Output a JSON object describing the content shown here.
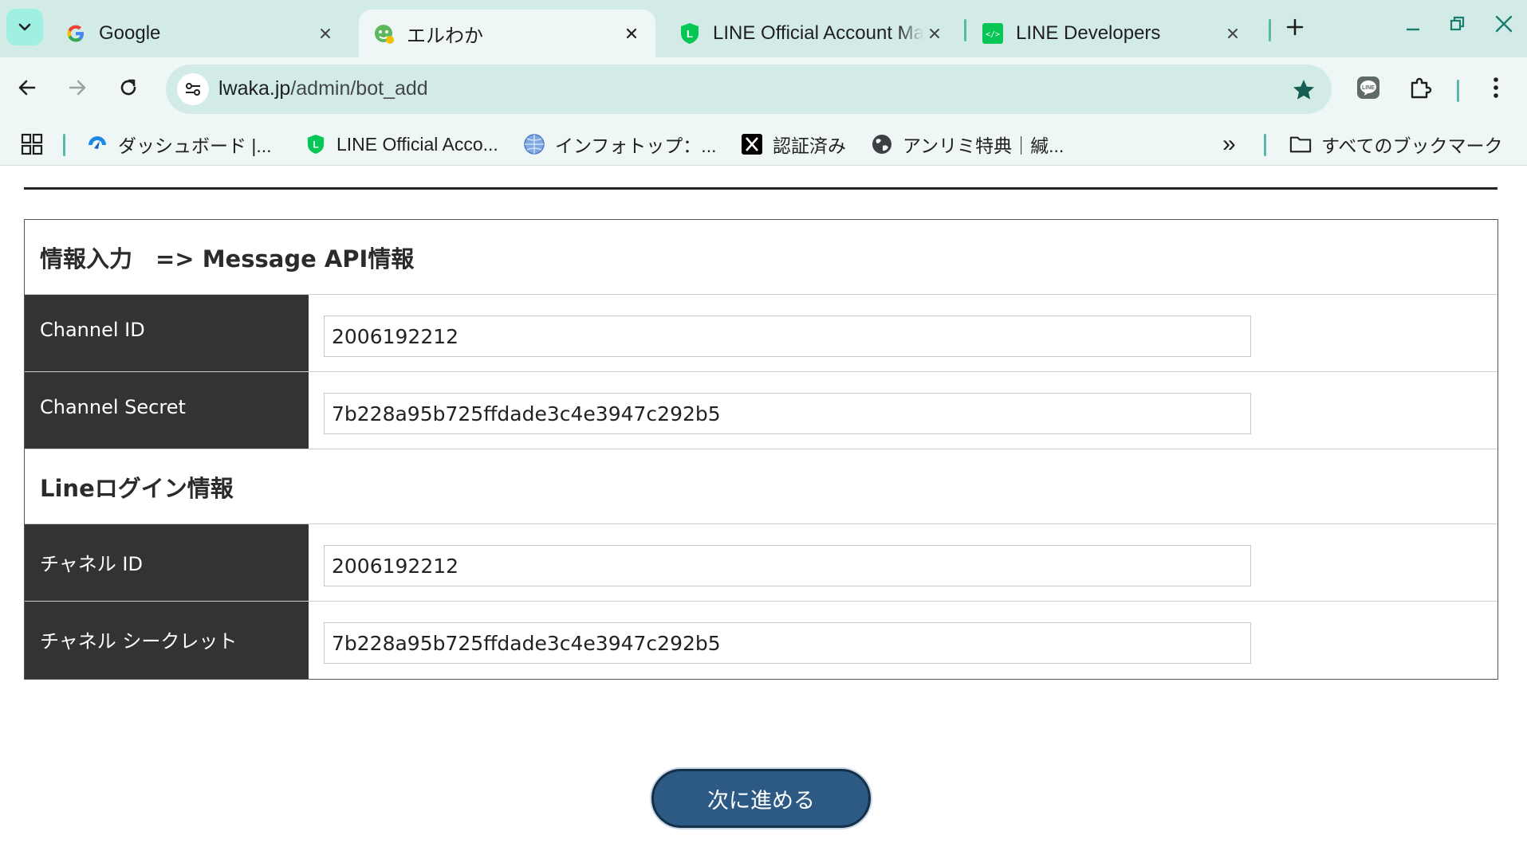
{
  "tabs": [
    {
      "title": "Google"
    },
    {
      "title": "エルわか"
    },
    {
      "title": "LINE Official Account Ma"
    },
    {
      "title": "LINE Developers"
    }
  ],
  "address": {
    "domain": "lwaka.jp",
    "path": "/admin/bot_add"
  },
  "bookmarks": [
    {
      "label": "ダッシュボード |..."
    },
    {
      "label": "LINE Official Acco..."
    },
    {
      "label": "インフォトップ：..."
    },
    {
      "label": "認証済み"
    },
    {
      "label": "アンリミ特典｜緘..."
    }
  ],
  "bookmarks_more": "»",
  "all_bookmarks": "すべてのブックマーク",
  "form": {
    "section1_title": "情報入力　=> Message API情報",
    "channel_id_label": "Channel ID",
    "channel_id_value": "2006192212",
    "channel_secret_label": "Channel Secret",
    "channel_secret_value": "7b228a95b725ffdade3c4e3947c292b5",
    "section2_title": "Lineログイン情報",
    "login_channel_id_label": "チャネル ID",
    "login_channel_id_value": "2006192212",
    "login_channel_secret_label": "チャネル シークレット",
    "login_channel_secret_value": "7b228a95b725ffdade3c4e3947c292b5"
  },
  "next_button": "次に進める",
  "colors": {
    "tabstrip": "#d3ebe7",
    "toolbar": "#eef7f5",
    "accent": "#1a7d6e",
    "label_bg": "#333333",
    "button": "#2c5a84"
  }
}
